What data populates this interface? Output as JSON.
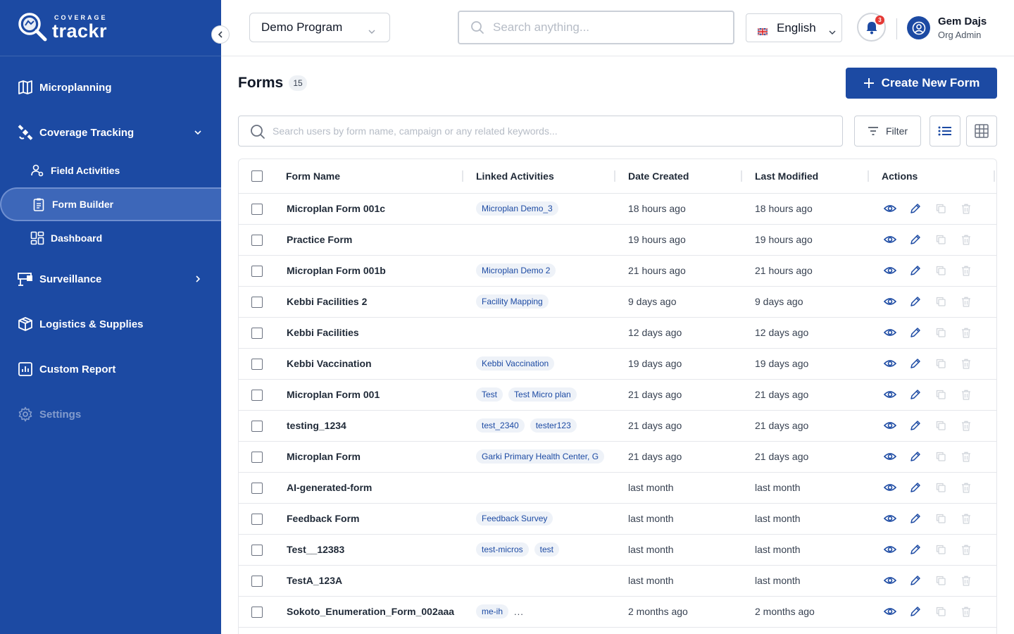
{
  "brand": {
    "top": "COVERAGE",
    "main": "trackr"
  },
  "sidebar": {
    "items": [
      {
        "label": "Microplanning",
        "icon": "map-icon"
      },
      {
        "label": "Coverage Tracking",
        "icon": "satellite-icon"
      },
      {
        "label": "Field Activities",
        "icon": "users-icon"
      },
      {
        "label": "Form Builder",
        "icon": "clipboard-icon"
      },
      {
        "label": "Dashboard",
        "icon": "dashboard-icon"
      },
      {
        "label": "Surveillance",
        "icon": "surveillance-icon"
      },
      {
        "label": "Logistics & Supplies",
        "icon": "box-icon"
      },
      {
        "label": "Custom Report",
        "icon": "report-icon"
      },
      {
        "label": "Settings",
        "icon": "gear-icon"
      }
    ]
  },
  "header": {
    "program": "Demo Program",
    "search_placeholder": "Search anything...",
    "language": "English",
    "notifications": "3",
    "user_name": "Gem Dajs",
    "user_role": "Org Admin"
  },
  "main": {
    "title": "Forms",
    "count": "15",
    "create_label": "Create New Form",
    "search_placeholder": "Search users by form name, campaign or any related keywords...",
    "filter_label": "Filter"
  },
  "table": {
    "columns": [
      "Form Name",
      "Linked Activities",
      "Date Created",
      "Last Modified",
      "Actions"
    ],
    "rows": [
      {
        "name": "Microplan Form 001c",
        "tags": [
          "Microplan Demo_3"
        ],
        "created": "18 hours ago",
        "modified": "18 hours ago"
      },
      {
        "name": "Practice Form",
        "tags": [],
        "created": "19 hours ago",
        "modified": "19 hours ago"
      },
      {
        "name": "Microplan Form 001b",
        "tags": [
          "Microplan Demo 2"
        ],
        "created": "21 hours ago",
        "modified": "21 hours ago"
      },
      {
        "name": "Kebbi Facilities 2",
        "tags": [
          "Facility Mapping"
        ],
        "created": "9 days ago",
        "modified": "9 days ago"
      },
      {
        "name": "Kebbi Facilities",
        "tags": [],
        "created": "12 days ago",
        "modified": "12 days ago"
      },
      {
        "name": "Kebbi Vaccination",
        "tags": [
          "Kebbi Vaccination"
        ],
        "created": "19 days ago",
        "modified": "19 days ago"
      },
      {
        "name": "Microplan Form 001",
        "tags": [
          "Test",
          "Test Micro plan"
        ],
        "created": "21 days ago",
        "modified": "21 days ago"
      },
      {
        "name": "testing_1234",
        "tags": [
          "test_2340",
          "tester123"
        ],
        "created": "21 days ago",
        "modified": "21 days ago"
      },
      {
        "name": "Microplan Form",
        "tags": [
          "Garki Primary Health Center, G"
        ],
        "created": "21 days ago",
        "modified": "21 days ago"
      },
      {
        "name": "AI-generated-form",
        "tags": [],
        "created": "last month",
        "modified": "last month"
      },
      {
        "name": "Feedback Form",
        "tags": [
          "Feedback Survey"
        ],
        "created": "last month",
        "modified": "last month"
      },
      {
        "name": "Test__12383",
        "tags": [
          "test-micros",
          "test"
        ],
        "created": "last month",
        "modified": "last month"
      },
      {
        "name": "TestA_123A",
        "tags": [],
        "created": "last month",
        "modified": "last month"
      },
      {
        "name": "Sokoto_Enumeration_Form_002aaa",
        "tags": [
          "me-ih"
        ],
        "more": "...",
        "created": "2 months ago",
        "modified": "2 months ago"
      }
    ]
  },
  "colors": {
    "primary": "#1c4aa3",
    "active_nav": "#3d67b9",
    "tag_bg": "#eef2f8",
    "badge": "#e53935"
  }
}
